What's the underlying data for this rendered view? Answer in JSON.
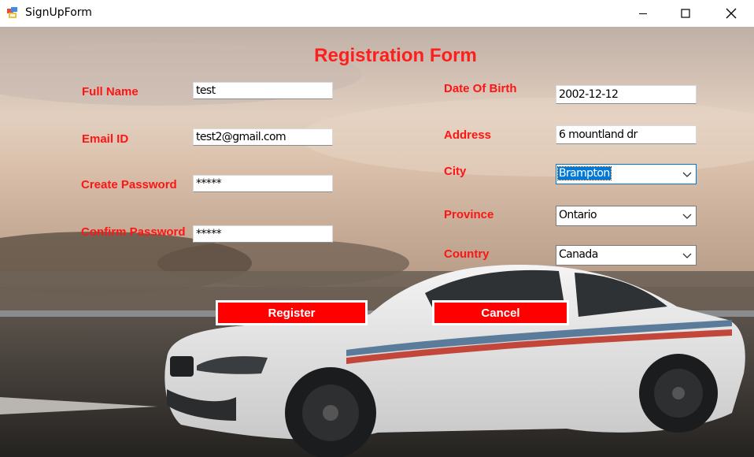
{
  "window": {
    "title": "SignUpForm"
  },
  "form": {
    "title": "Registration Form",
    "full_name": {
      "label": "Full Name",
      "value": "test"
    },
    "email": {
      "label": "Email ID",
      "value": "test2@gmail.com"
    },
    "create_password": {
      "label": "Create Password",
      "value": "*****"
    },
    "confirm_password": {
      "label": "Confirm Password",
      "value": "*****"
    },
    "dob": {
      "label": "Date Of Birth",
      "value": "2002-12-12"
    },
    "address": {
      "label": "Address",
      "value": "6 mountland dr"
    },
    "city": {
      "label": "City",
      "value": "Brampton"
    },
    "province": {
      "label": "Province",
      "value": "Ontario"
    },
    "country": {
      "label": "Country",
      "value": "Canada"
    },
    "register_label": "Register",
    "cancel_label": "Cancel"
  },
  "colors": {
    "label": "#ff1414",
    "button_bg": "#ff0000",
    "title": "#ff1e1e",
    "focus_border": "#0078d7"
  },
  "icons": [
    "app-icon",
    "minimize-icon",
    "maximize-icon",
    "close-icon",
    "chevron-down-icon"
  ]
}
